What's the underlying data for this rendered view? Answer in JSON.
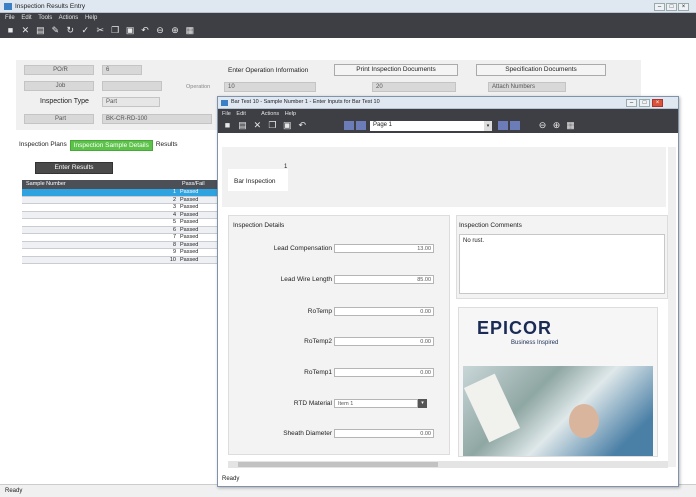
{
  "main": {
    "title": "Inspection Results Entry",
    "menu": [
      "File",
      "Edit",
      "Tools",
      "Actions",
      "Help"
    ],
    "form": {
      "row1_label": "PO/R",
      "row1_value": "6",
      "row2_label": "Job",
      "type_label": "Inspection Type",
      "type_value": "Part",
      "part_label": "Part",
      "part_value": "BK-CR-RD-100",
      "op_info_label": "Enter Operation Information",
      "op_sub_label": "Operation",
      "op_value": "10",
      "op_value2": "20",
      "print_button": "Print Inspection Documents",
      "spec_button": "Specification Documents",
      "spec_field": "Attach Numbers"
    },
    "tabs": [
      "Inspection Plans",
      "Inspection Sample Details",
      "Results"
    ],
    "enter_results_button": "Enter Results",
    "grid": {
      "col1": "Sample Number",
      "col2": "Pass/Fail",
      "rows": [
        {
          "num": "1",
          "status": "Passed"
        },
        {
          "num": "2",
          "status": "Passed"
        },
        {
          "num": "3",
          "status": "Passed"
        },
        {
          "num": "4",
          "status": "Passed"
        },
        {
          "num": "5",
          "status": "Passed"
        },
        {
          "num": "6",
          "status": "Passed"
        },
        {
          "num": "7",
          "status": "Passed"
        },
        {
          "num": "8",
          "status": "Passed"
        },
        {
          "num": "9",
          "status": "Passed"
        },
        {
          "num": "10",
          "status": "Passed"
        }
      ]
    },
    "status": "Ready"
  },
  "dialog": {
    "title": "Bar Test 10 - Sample Number 1 - Enter Inputs for Bar Test 10",
    "menu": [
      "File",
      "Edit",
      "Actions",
      "Help"
    ],
    "page_select": "Page 1",
    "tab_number": "1",
    "tab_label": "Bar Inspection",
    "details_header": "Inspection Details",
    "comments_header": "Inspection Comments",
    "comment_text": "No rust.",
    "fields": [
      {
        "label": "Lead Compensation",
        "value": "13.00"
      },
      {
        "label": "Lead Wire Length",
        "value": "85.00"
      },
      {
        "label": "RoTemp",
        "value": "0.00"
      },
      {
        "label": "RoTemp2",
        "value": "0.00"
      },
      {
        "label": "RoTemp1",
        "value": "0.00"
      }
    ],
    "material_label": "RTD Material",
    "material_value": "Item 1",
    "sheath_label": "Sheath Diameter",
    "sheath_value": "0.00",
    "logo": "EPICOR",
    "tagline": "Business Inspired",
    "status": "Ready"
  },
  "colors": {
    "accent": "#5cc24a",
    "selected_row": "#2ea3e0",
    "toolbar": "#3e3f44"
  }
}
